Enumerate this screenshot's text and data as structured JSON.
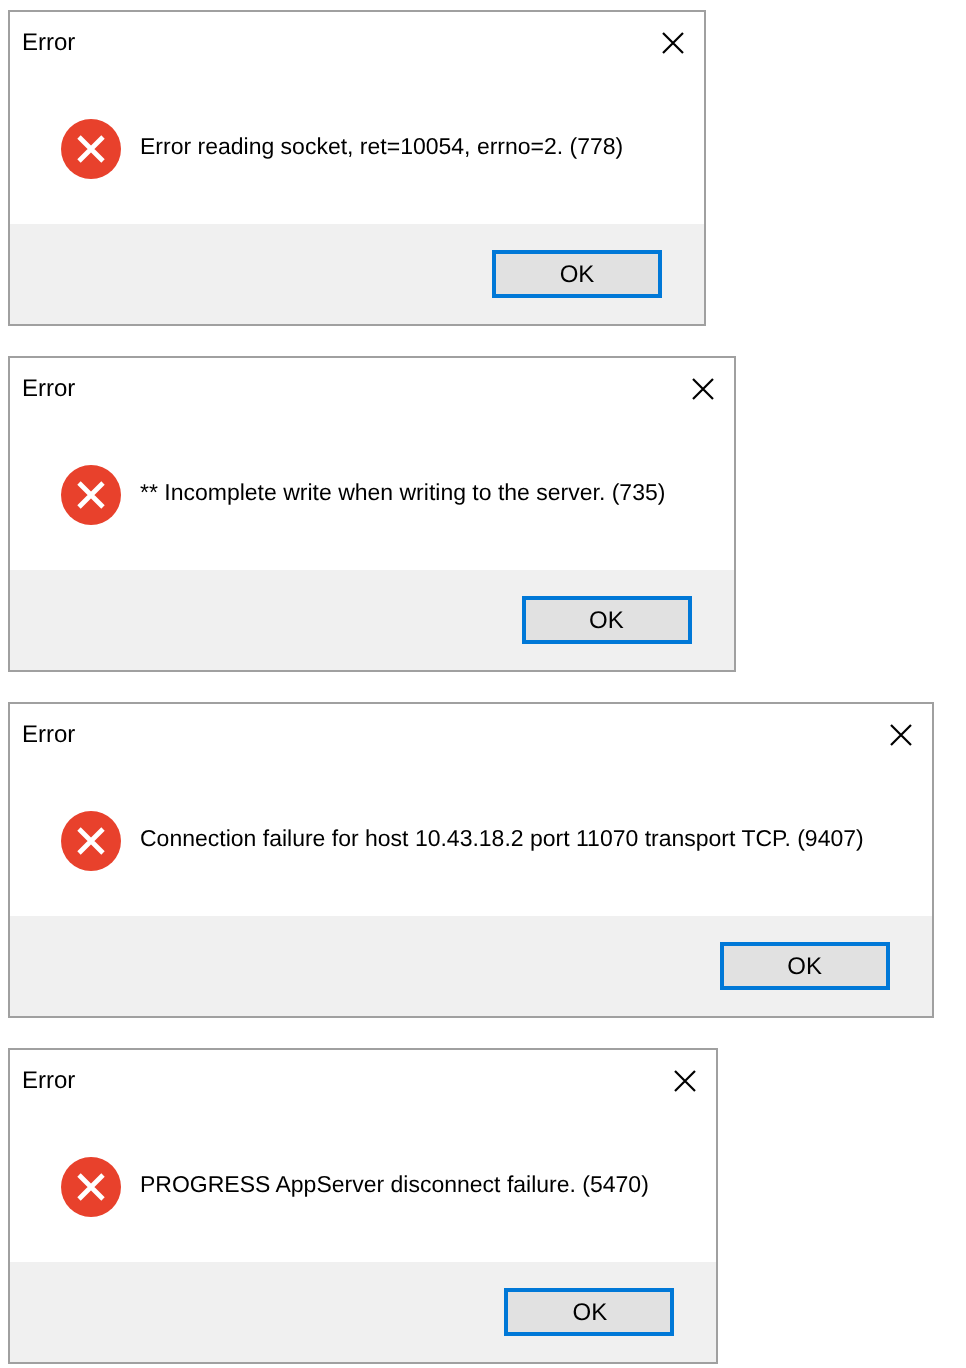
{
  "dialogs": [
    {
      "title": "Error",
      "message": "Error reading socket, ret=10054, errno=2. (778)",
      "button": "OK"
    },
    {
      "title": "Error",
      "message": "** Incomplete write when writing to the server. (735)",
      "button": "OK"
    },
    {
      "title": "Error",
      "message": "Connection failure for host 10.43.18.2 port 11070 transport TCP. (9407)",
      "button": "OK"
    },
    {
      "title": "Error",
      "message": "PROGRESS AppServer disconnect failure. (5470)",
      "button": "OK"
    }
  ]
}
